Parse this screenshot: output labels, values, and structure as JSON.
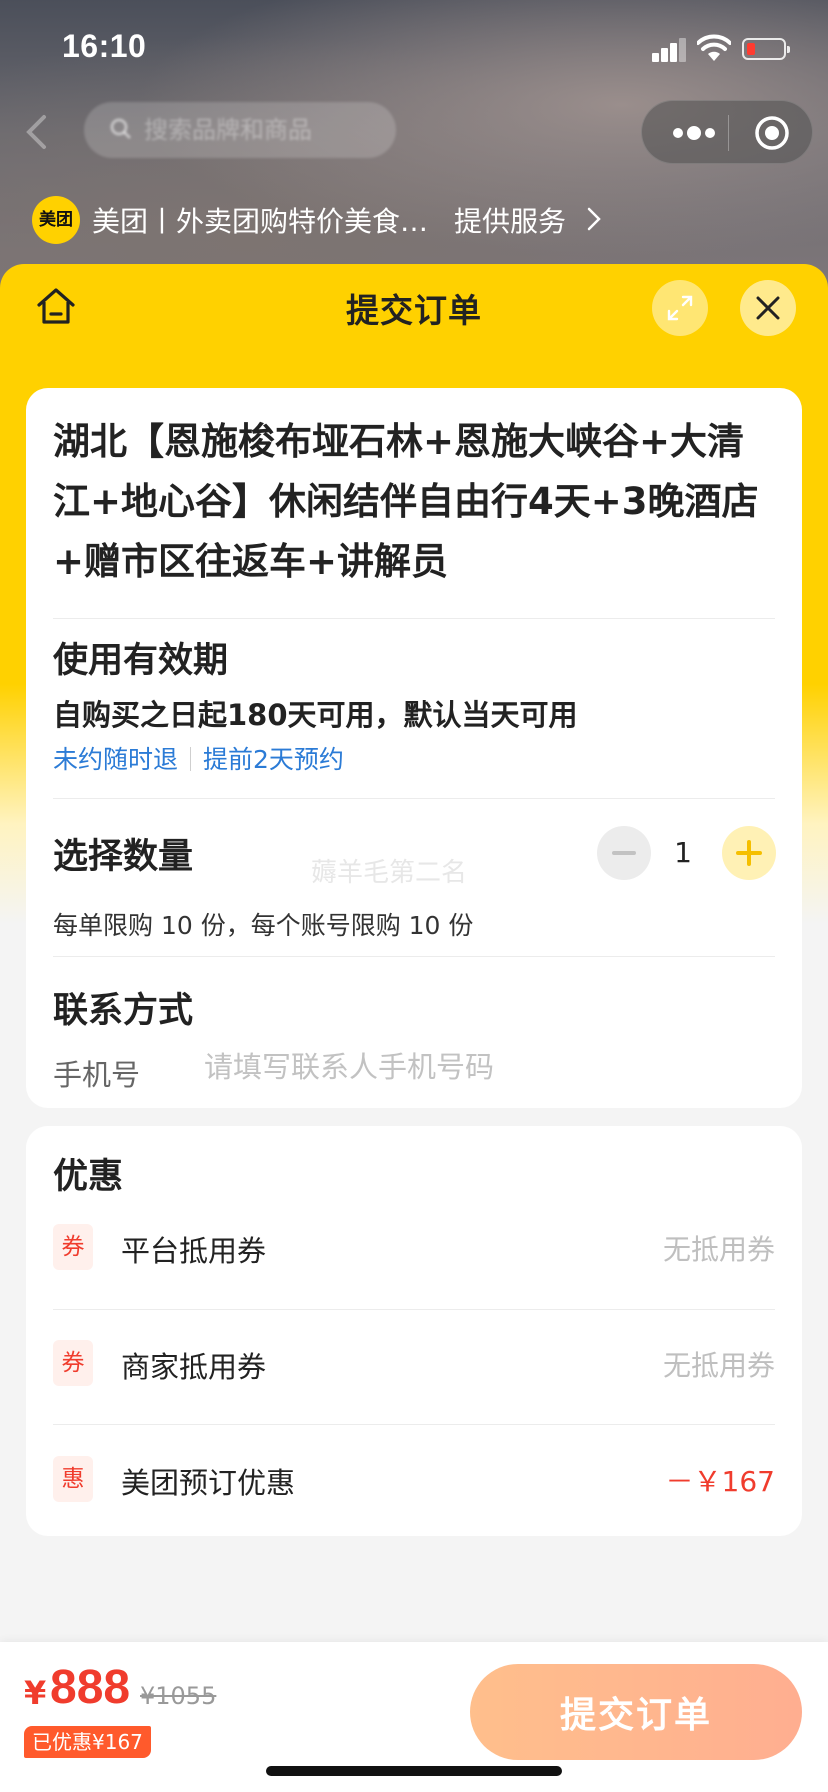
{
  "status_bar": {
    "time": "16:10"
  },
  "miniprogram_nav": {
    "search_placeholder": "搜索品牌和商品"
  },
  "provider": {
    "logo_text": "美团",
    "name": "美团丨外卖团购特价美食酒店电影",
    "service_link": "提供服务"
  },
  "sheet": {
    "title": "提交订单"
  },
  "product": {
    "title": "湖北【恩施梭布垭石林+恩施大峡谷+大清江+地心谷】休闲结伴自由行4天+3晚酒店+赠市区往返车+讲解员"
  },
  "validity": {
    "heading": "使用有效期",
    "text": "自购买之日起180天可用，默认当天可用",
    "tag_refund": "未约随时退",
    "tag_booking": "提前2天预约"
  },
  "quantity": {
    "heading": "选择数量",
    "value": "1",
    "limit_text": "每单限购 10 份，每个账号限购 10 份",
    "watermark": "薅羊毛第二名"
  },
  "contact": {
    "heading": "联系方式",
    "phone_label": "手机号",
    "phone_placeholder": "请填写联系人手机号码",
    "phone_value": ""
  },
  "discounts": {
    "heading": "优惠",
    "rows": [
      {
        "badge": "券",
        "label": "平台抵用券",
        "value": "无抵用券",
        "highlight": false
      },
      {
        "badge": "券",
        "label": "商家抵用券",
        "value": "无抵用券",
        "highlight": false
      },
      {
        "badge": "惠",
        "label": "美团预订优惠",
        "value": "－￥167",
        "highlight": true
      }
    ]
  },
  "bottom_bar": {
    "currency": "¥",
    "price": "888",
    "original_price": "¥1055",
    "saved_badge": "已优惠¥167",
    "submit_label": "提交订单"
  },
  "colors": {
    "brand_yellow": "#ffd100",
    "price_red": "#f03c2d",
    "link_blue": "#2b7bd6",
    "submit_gradient_start": "#ffbf8c",
    "submit_gradient_end": "#ffae90"
  }
}
